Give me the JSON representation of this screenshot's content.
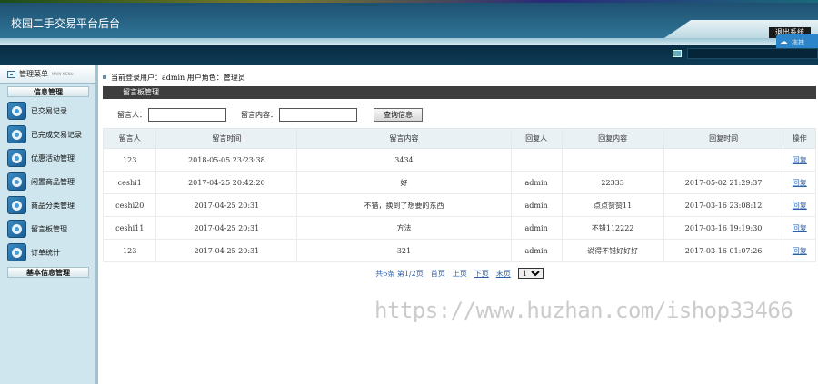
{
  "header": {
    "title": "校园二手交易平台后台",
    "logout_label": "退出系统",
    "weibo_label": "拖拽"
  },
  "sidebar": {
    "menu_title": "管理菜单",
    "menu_subtitle": "MAIN MENU",
    "section1": "信息管理",
    "items": [
      {
        "label": "已交易记录",
        "icon": "gear-icon"
      },
      {
        "label": "已完成交易记录",
        "icon": "gear-icon"
      },
      {
        "label": "优惠活动管理",
        "icon": "gear-icon"
      },
      {
        "label": "闲置商品管理",
        "icon": "gear-icon"
      },
      {
        "label": "商品分类管理",
        "icon": "gear-icon"
      },
      {
        "label": "留言板管理",
        "icon": "gear-icon"
      },
      {
        "label": "订单统计",
        "icon": "gear-icon"
      }
    ],
    "section2": "基本信息管理"
  },
  "topbar": {
    "text": "当前登录用户：admin 用户角色：管理员"
  },
  "panel": {
    "title": "留言板管理",
    "search": {
      "author_label": "留言人：",
      "author_value": "",
      "content_label": "留言内容：",
      "content_value": "",
      "button_label": "查询信息"
    },
    "table": {
      "headers": [
        "留言人",
        "留言时间",
        "留言内容",
        "回复人",
        "回复内容",
        "回复时间",
        "操作"
      ],
      "rows": [
        [
          "123",
          "2018-05-05 23:23:38",
          "3434",
          "",
          "",
          "",
          "回复"
        ],
        [
          "ceshi1",
          "2017-04-25 20:42:20",
          "好",
          "admin",
          "22333",
          "2017-05-02 21:29:37",
          "回复"
        ],
        [
          "ceshi20",
          "2017-04-25 20:31",
          "不错，换到了想要的东西",
          "admin",
          "点点赞赞11",
          "2017-03-16 23:08:12",
          "回复"
        ],
        [
          "ceshi11",
          "2017-04-25 20:31",
          "方法",
          "admin",
          "不错112222",
          "2017-03-16 19:19:30",
          "回复"
        ],
        [
          "123",
          "2017-04-25 20:31",
          "321",
          "admin",
          "说得不错好好好",
          "2017-03-16 01:07:26",
          "回复"
        ]
      ]
    },
    "pager": {
      "summary": "共6条 第1/2页",
      "first": "首页",
      "prev": "上页",
      "next": "下页",
      "last": "末页",
      "page_select": "1"
    }
  },
  "watermark": "https://www.huzhan.com/ishop33466",
  "colors": {
    "header_dark": "#0f3c57",
    "header_mid": "#2b6c8e",
    "sidebar_bg": "#cfe6ee",
    "panel_head": "#3d3d3d",
    "link": "#2c5fa8"
  }
}
